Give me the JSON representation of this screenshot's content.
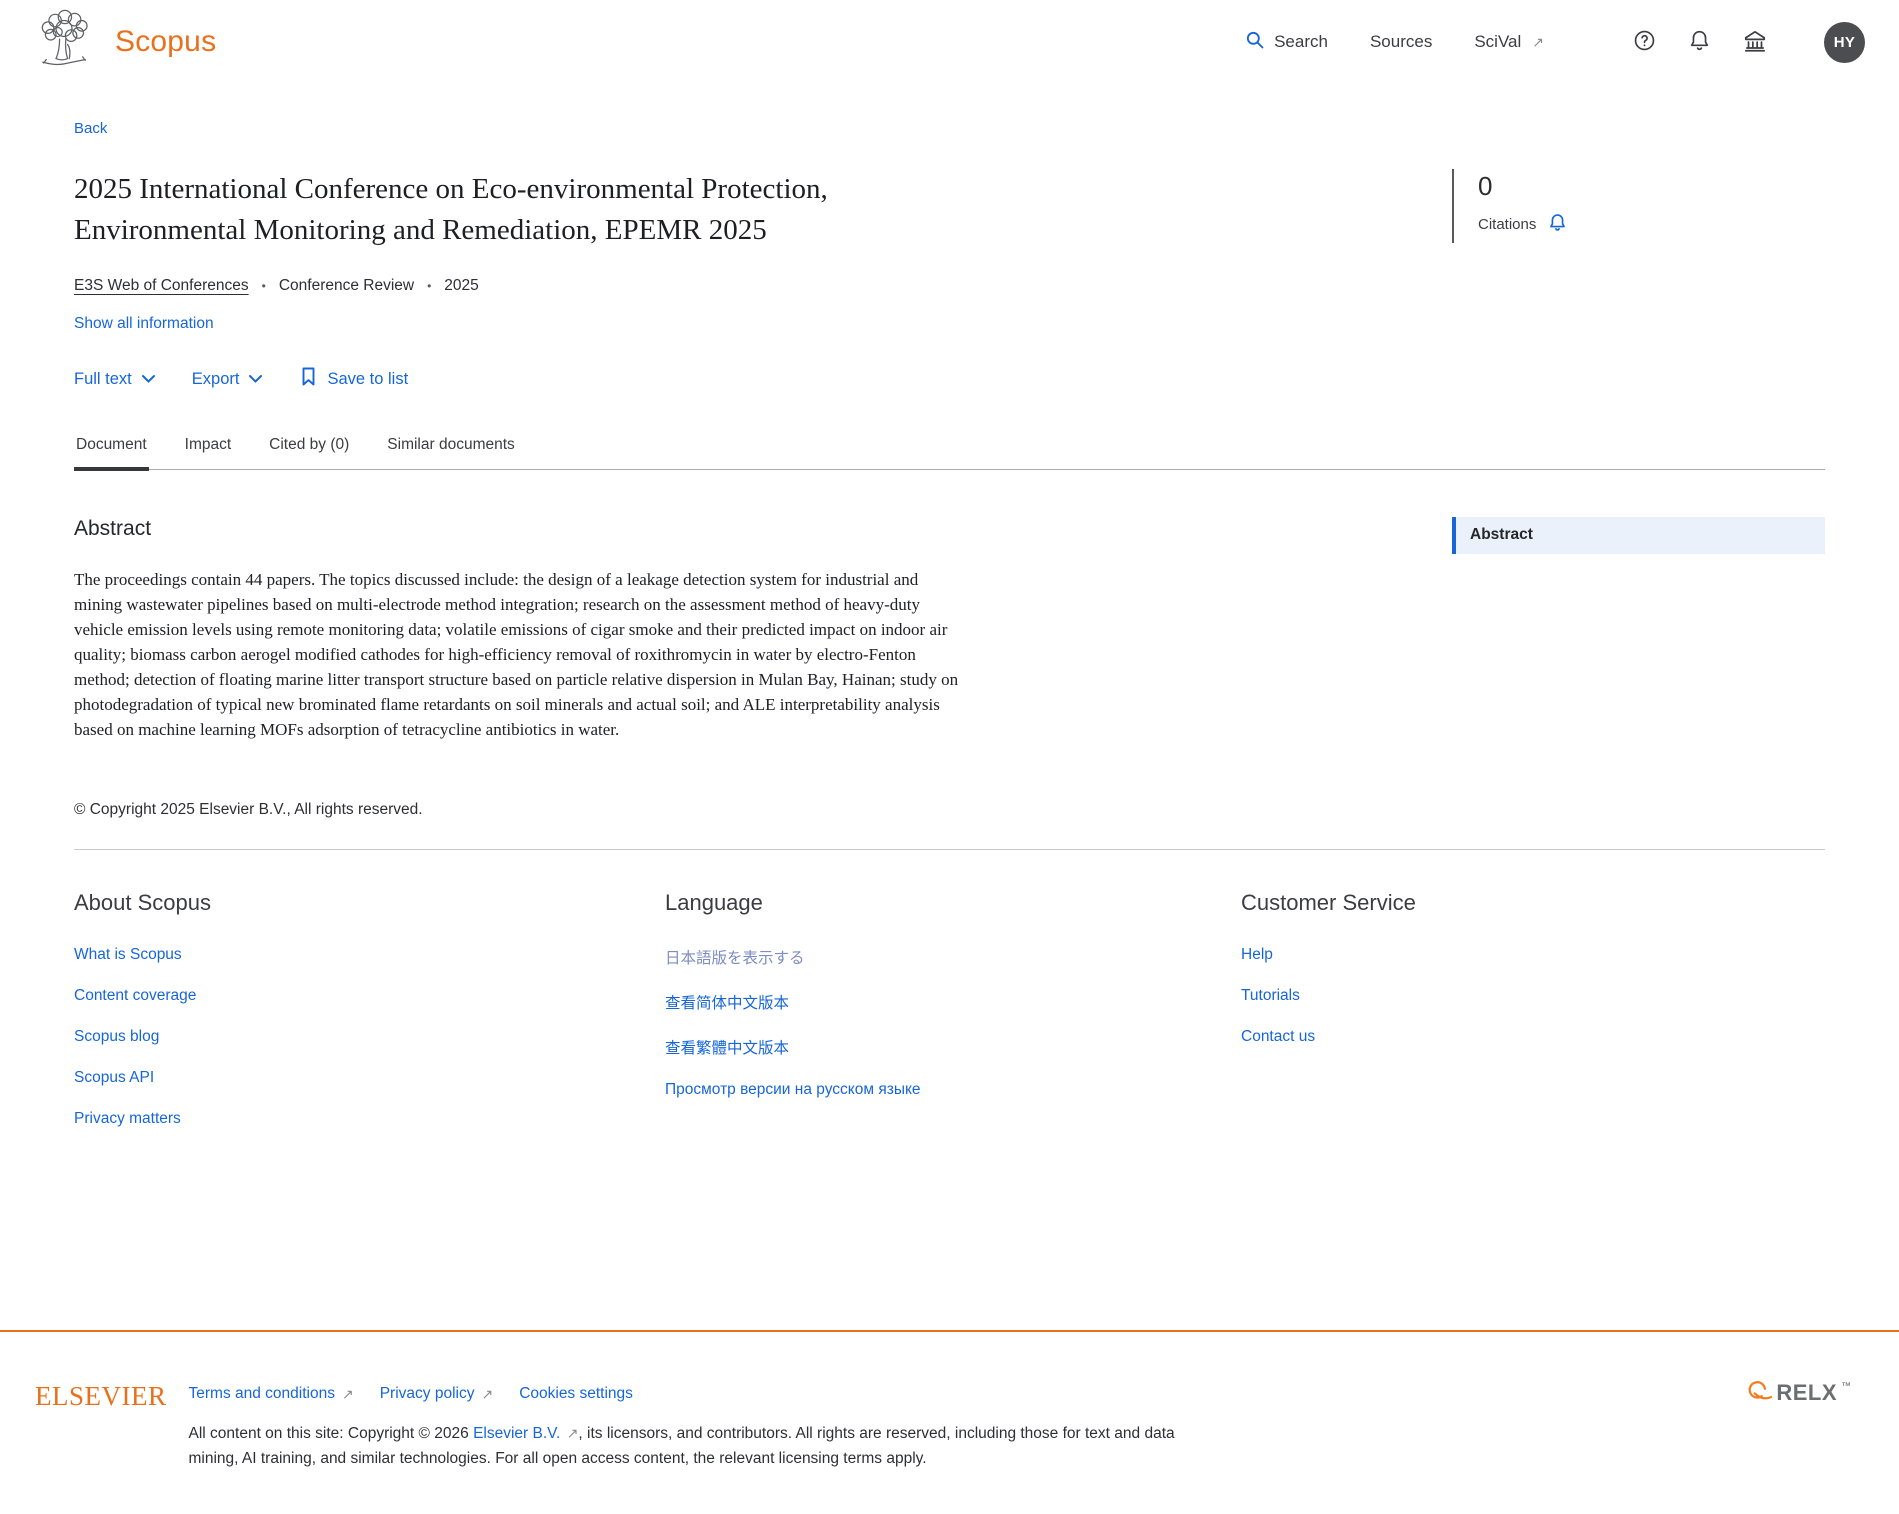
{
  "colors": {
    "accent_orange": "#e9711c",
    "link_blue": "#1766d8",
    "text_dark": "#2e2f33"
  },
  "icons": {
    "external": "↗",
    "search": "magnifier",
    "help": "question-circle",
    "alerts": "bell",
    "institution": "bank",
    "save": "bookmark",
    "citation_alert": "bell"
  },
  "header": {
    "brand": "Scopus",
    "nav": [
      {
        "label": "Search"
      },
      {
        "label": "Sources"
      },
      {
        "label": "SciVal"
      }
    ],
    "avatar_initials": "HY"
  },
  "page": {
    "back": "Back",
    "title": "2025 International Conference on Eco-environmental Protection, Environmental Monitoring and Remediation, EPEMR 2025",
    "source": "E3S Web of Conferences",
    "doc_type": "Conference Review",
    "year": "2025",
    "meta_sep": "•",
    "show_all": "Show all information",
    "actions": {
      "full_text": "Full text",
      "export": "Export",
      "save": "Save to list"
    },
    "tabs": [
      {
        "label": "Document"
      },
      {
        "label": "Impact"
      },
      {
        "label": "Cited by (0)"
      },
      {
        "label": "Similar documents"
      }
    ],
    "metrics": {
      "count": "0",
      "label": "Citations"
    },
    "abstract": {
      "heading": "Abstract",
      "text": "The proceedings contain 44 papers. The topics discussed include: the design of a leakage detection system for industrial and mining wastewater pipelines based on multi-electrode method integration; research on the assessment method of heavy-duty vehicle emission levels using remote monitoring data; volatile emissions of cigar smoke and their predicted impact on indoor air quality; biomass carbon aerogel modified cathodes for high-efficiency removal of roxithromycin in water by electro-Fenton method; detection of floating marine litter transport structure based on particle relative dispersion in Mulan Bay, Hainan; study on photodegradation of typical new brominated flame retardants on soil minerals and actual soil; and ALE interpretability analysis based on machine learning MOFs adsorption of tetracycline antibiotics in water."
    },
    "side_nav": {
      "label": "Abstract"
    },
    "copyright": "© Copyright 2025 Elsevier B.V., All rights reserved."
  },
  "footer": {
    "about": {
      "heading": "About Scopus",
      "links": [
        {
          "label": "What is Scopus"
        },
        {
          "label": "Content coverage"
        },
        {
          "label": "Scopus blog"
        },
        {
          "label": "Scopus API"
        },
        {
          "label": "Privacy matters"
        }
      ]
    },
    "language": {
      "heading": "Language",
      "links": [
        {
          "label": "日本語版を表示する"
        },
        {
          "label": "查看简体中文版本"
        },
        {
          "label": "查看繁體中文版本"
        },
        {
          "label": "Просмотр версии на русском языке"
        }
      ]
    },
    "customer": {
      "heading": "Customer Service",
      "links": [
        {
          "label": "Help"
        },
        {
          "label": "Tutorials"
        },
        {
          "label": "Contact us"
        }
      ]
    }
  },
  "bottom": {
    "elsevier": "ELSEVIER",
    "links": [
      {
        "label": "Terms and conditions",
        "external": true
      },
      {
        "label": "Privacy policy",
        "external": true
      },
      {
        "label": "Cookies settings",
        "external": false
      }
    ],
    "legal_part1": "All content on this site: Copyright © 2026 ",
    "legal_link": "Elsevier B.V.",
    "legal_part2": ", its licensors, and contributors. All rights are reserved, including those for text and data mining, AI training, and similar technologies. For all open access content, the relevant licensing terms apply.",
    "relx": "RELX",
    "relx_tm": "™"
  }
}
